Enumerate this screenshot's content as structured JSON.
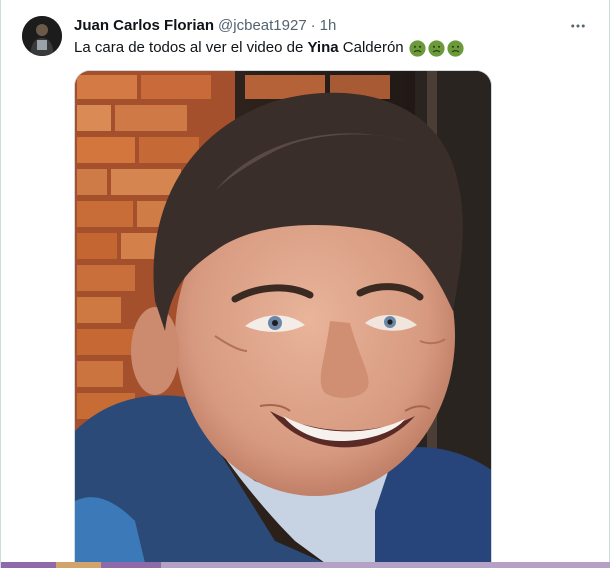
{
  "tweet": {
    "display_name": "Juan Carlos Florian",
    "handle": "@jcbeat1927",
    "separator": "·",
    "time": "1h",
    "text_before": "La cara de todos al ver el video de ",
    "text_bold": "Yina",
    "text_after": " Calderón",
    "emojis": [
      "nauseated-face-emoji",
      "nauseated-face-emoji",
      "nauseated-face-emoji"
    ],
    "more_icon": "more-horizontal-icon",
    "media_icon": "photo-of-smiling-man"
  },
  "colors": {
    "text_primary": "#0f1419",
    "text_secondary": "#536471",
    "border": "#cfd9de",
    "emoji_green": "#6b9a3a",
    "bottom_bar": [
      "#8e6ba8",
      "#d2a36b",
      "#8e6ba8",
      "#b5a1c6"
    ]
  }
}
